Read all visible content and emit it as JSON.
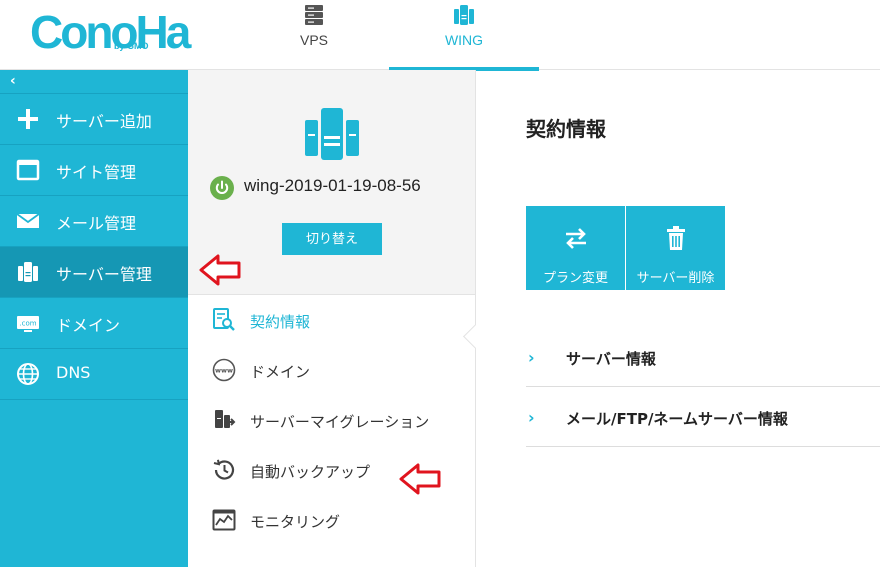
{
  "header": {
    "logo": "ConoHa",
    "logo_sub": "by GMO",
    "tabs": [
      {
        "label": "VPS",
        "icon": "server-stack-icon"
      },
      {
        "label": "WING",
        "icon": "wing-server-icon",
        "active": true
      }
    ]
  },
  "sidebar": {
    "collapse_icon": "‹",
    "items": [
      {
        "label": "サーバー追加",
        "icon": "plus-icon"
      },
      {
        "label": "サイト管理",
        "icon": "window-icon"
      },
      {
        "label": "メール管理",
        "icon": "envelope-icon"
      },
      {
        "label": "サーバー管理",
        "icon": "server-icon",
        "active": true
      },
      {
        "label": "ドメイン",
        "icon": "com-domain-icon"
      },
      {
        "label": "DNS",
        "icon": "globe-icon"
      }
    ]
  },
  "server_panel": {
    "server_name": "wing-2019-01-19-08-56",
    "status": "on",
    "switch_label": "切り替え",
    "menu": [
      {
        "label": "契約情報",
        "icon": "contract-search-icon",
        "active": true
      },
      {
        "label": "ドメイン",
        "icon": "www-icon"
      },
      {
        "label": "サーバーマイグレーション",
        "icon": "migration-icon"
      },
      {
        "label": "自動バックアップ",
        "icon": "backup-clock-icon"
      },
      {
        "label": "モニタリング",
        "icon": "monitoring-icon"
      }
    ]
  },
  "content": {
    "title": "契約情報",
    "actions": [
      {
        "label": "プラン変更",
        "icon": "swap-arrows-icon"
      },
      {
        "label": "サーバー削除",
        "icon": "trash-icon"
      }
    ],
    "sections": [
      {
        "label": "サーバー情報"
      },
      {
        "label": "メール/FTP/ネームサーバー情報"
      }
    ],
    "chevron": "›"
  },
  "colors": {
    "accent": "#1fb6d5",
    "sidebar_active": "#1597b4",
    "power_green": "#6ab04c",
    "annotation_red": "#e0141e"
  }
}
